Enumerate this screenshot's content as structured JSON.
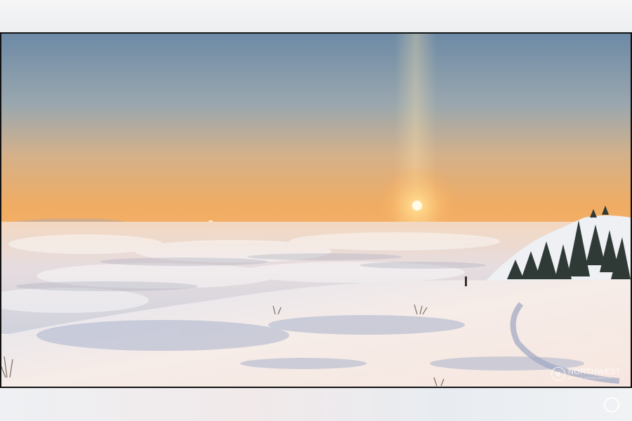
{
  "scene": {
    "sky_top": "#6d8aa6",
    "sky_mid": "#c7b39a",
    "sky_horizon": "#f2b064",
    "sun": "#fff4c4",
    "cloud_sea": "#e9e2e6",
    "snow": "#f5ece9",
    "snow_shadow": "#b9c0d4"
  },
  "watermark": {
    "brand": "NORTHWEST",
    "tagline": "MULTIPLE LISTING SERVICE",
    "logo_text": "M"
  }
}
